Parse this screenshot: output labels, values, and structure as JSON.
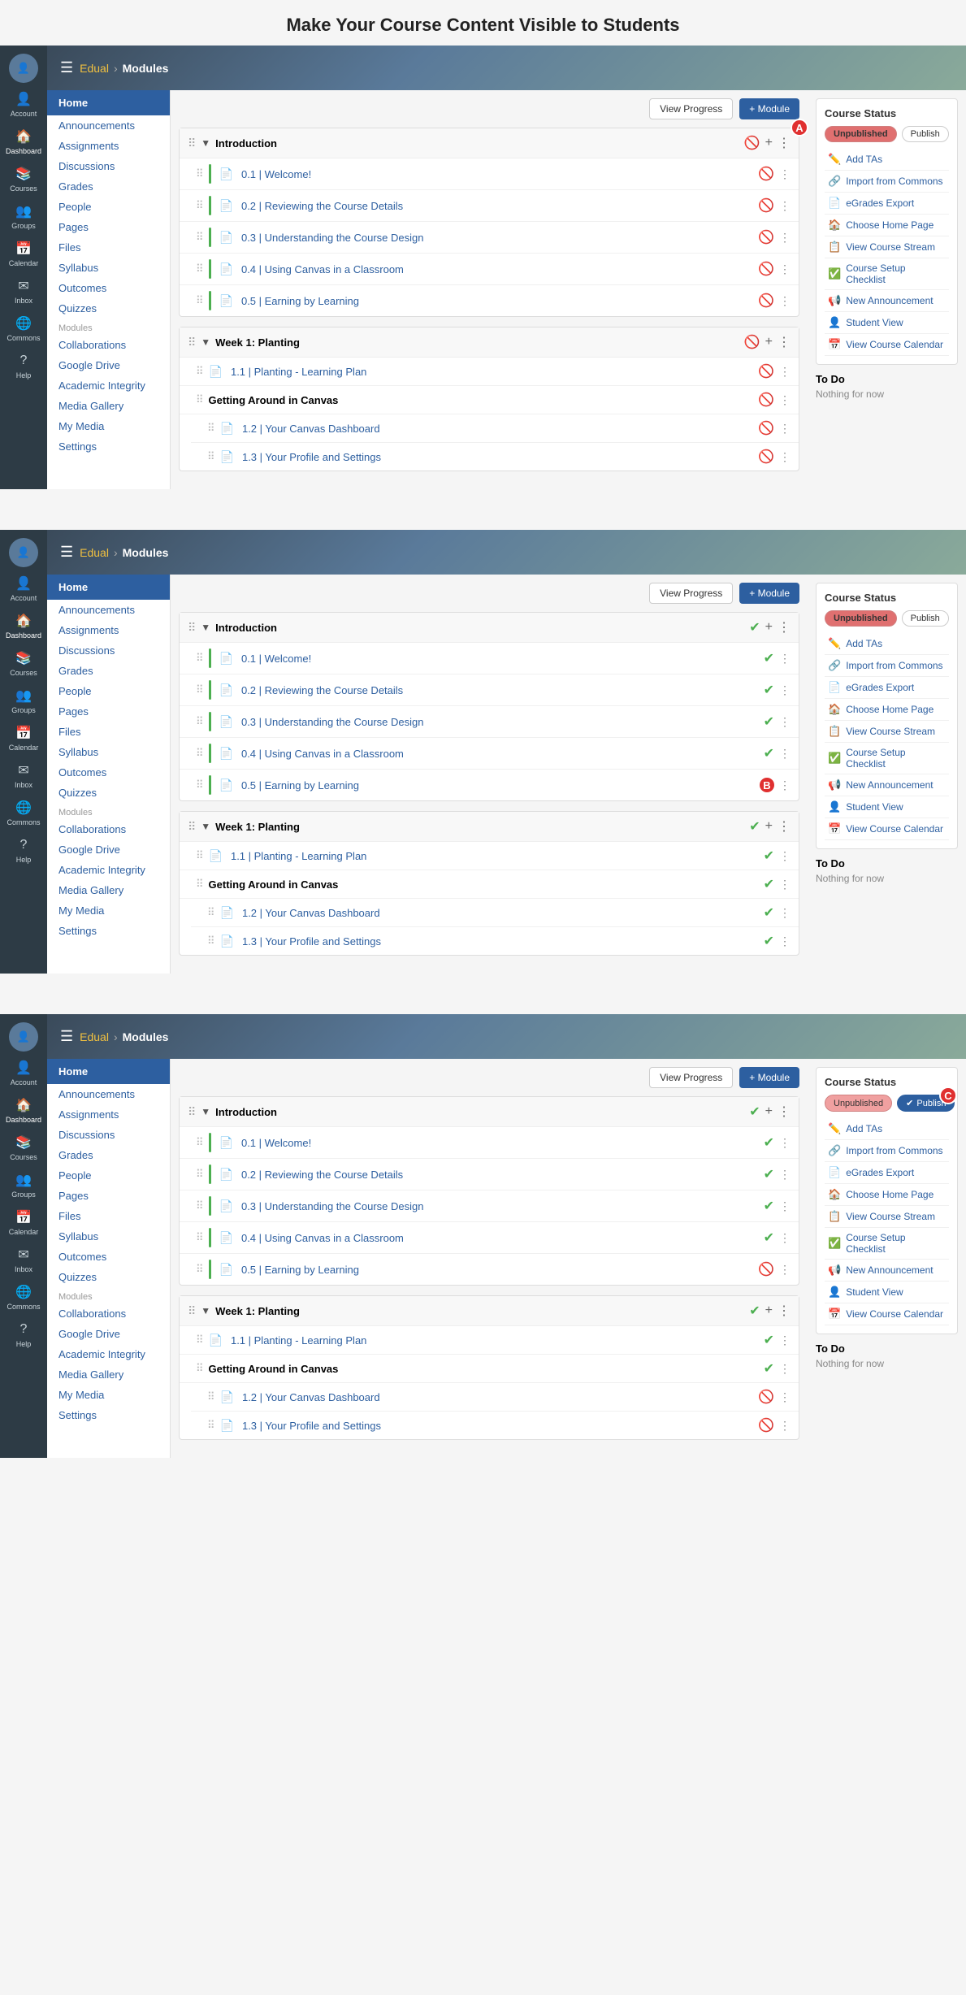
{
  "page": {
    "title": "Make Your Course Content Visible to Students"
  },
  "screens": [
    {
      "id": "screen-a",
      "annotation": "A",
      "banner": {
        "breadcrumb_link": "Edual",
        "breadcrumb_current": "Modules"
      },
      "left_nav": {
        "home": "Home",
        "items": [
          "Announcements",
          "Assignments",
          "Discussions",
          "Grades",
          "People",
          "Pages",
          "Files",
          "Syllabus",
          "Outcomes",
          "Quizzes",
          "Modules",
          "Collaborations",
          "Google Drive",
          "Academic Integrity",
          "Media Gallery",
          "My Media",
          "Settings"
        ]
      },
      "module_area": {
        "btn_view_progress": "View Progress",
        "btn_add_module": "+ Module",
        "modules": [
          {
            "title": "Introduction",
            "published": false,
            "items": [
              {
                "title": "0.1 | Welcome!",
                "has_bar": true,
                "published": false
              },
              {
                "title": "0.2 | Reviewing the Course Details",
                "has_bar": true,
                "published": false
              },
              {
                "title": "0.3 | Understanding the Course Design",
                "has_bar": true,
                "published": false
              },
              {
                "title": "0.4 | Using Canvas in a Classroom",
                "has_bar": true,
                "published": false
              },
              {
                "title": "0.5 | Earning by Learning",
                "has_bar": true,
                "published": false
              }
            ]
          },
          {
            "title": "Week 1: Planting",
            "published": false,
            "items": [
              {
                "title": "1.1 | Planting - Learning Plan",
                "has_bar": false,
                "published": false
              },
              {
                "sub_title": "Getting Around in Canvas",
                "published": false
              },
              {
                "title": "1.2 | Your Canvas Dashboard",
                "has_bar": false,
                "indent": true,
                "published": false
              },
              {
                "title": "1.3 | Your Profile and Settings",
                "has_bar": false,
                "indent": true,
                "published": false
              }
            ]
          }
        ]
      },
      "course_status": {
        "title": "Course Status",
        "unpublished_active": true,
        "publish_active": false,
        "actions": [
          "Add TAs",
          "Import from Commons",
          "eGrades Export",
          "Choose Home Page",
          "View Course Stream",
          "Course Setup Checklist",
          "New Announcement",
          "Student View",
          "View Course Calendar"
        ]
      },
      "todo": {
        "title": "To Do",
        "empty": "Nothing for now"
      }
    },
    {
      "id": "screen-b",
      "annotation": "B",
      "banner": {
        "breadcrumb_link": "Edual",
        "breadcrumb_current": "Modules"
      },
      "left_nav": {
        "home": "Home",
        "items": [
          "Announcements",
          "Assignments",
          "Discussions",
          "Grades",
          "People",
          "Pages",
          "Files",
          "Syllabus",
          "Outcomes",
          "Quizzes",
          "Modules",
          "Collaborations",
          "Google Drive",
          "Academic Integrity",
          "Media Gallery",
          "My Media",
          "Settings"
        ]
      },
      "module_area": {
        "btn_view_progress": "View Progress",
        "btn_add_module": "+ Module",
        "modules": [
          {
            "title": "Introduction",
            "published": true,
            "items": [
              {
                "title": "0.1 | Welcome!",
                "has_bar": true,
                "published": true
              },
              {
                "title": "0.2 | Reviewing the Course Details",
                "has_bar": true,
                "published": true
              },
              {
                "title": "0.3 | Understanding the Course Design",
                "has_bar": true,
                "published": true
              },
              {
                "title": "0.4 | Using Canvas in a Classroom",
                "has_bar": true,
                "published": true
              },
              {
                "title": "0.5 | Earning by Learning",
                "has_bar": true,
                "published": true
              }
            ]
          },
          {
            "title": "Week 1: Planting",
            "published": true,
            "items": [
              {
                "title": "1.1 | Planting - Learning Plan",
                "has_bar": false,
                "published": true
              },
              {
                "sub_title": "Getting Around in Canvas",
                "published": true
              },
              {
                "title": "1.2 | Your Canvas Dashboard",
                "has_bar": false,
                "indent": true,
                "published": true
              },
              {
                "title": "1.3 | Your Profile and Settings",
                "has_bar": false,
                "indent": true,
                "published": true
              }
            ]
          }
        ]
      },
      "course_status": {
        "title": "Course Status",
        "unpublished_active": true,
        "publish_active": false,
        "actions": [
          "Add TAs",
          "Import from Commons",
          "eGrades Export",
          "Choose Home Page",
          "View Course Stream",
          "Course Setup Checklist",
          "New Announcement",
          "Student View",
          "View Course Calendar"
        ]
      },
      "todo": {
        "title": "To Do",
        "empty": "Nothing for now"
      }
    },
    {
      "id": "screen-c",
      "annotation": "C",
      "banner": {
        "breadcrumb_link": "Edual",
        "breadcrumb_current": "Modules"
      },
      "left_nav": {
        "home": "Home",
        "items": [
          "Announcements",
          "Assignments",
          "Discussions",
          "Grades",
          "People",
          "Pages",
          "Files",
          "Syllabus",
          "Outcomes",
          "Quizzes",
          "Modules",
          "Collaborations",
          "Google Drive",
          "Academic Integrity",
          "Media Gallery",
          "My Media",
          "Settings"
        ]
      },
      "module_area": {
        "btn_view_progress": "View Progress",
        "btn_add_module": "+ Module",
        "modules": [
          {
            "title": "Introduction",
            "published": true,
            "items": [
              {
                "title": "0.1 | Welcome!",
                "has_bar": true,
                "published": true
              },
              {
                "title": "0.2 | Reviewing the Course Details",
                "has_bar": true,
                "published": true
              },
              {
                "title": "0.3 | Understanding the Course Design",
                "has_bar": true,
                "published": true
              },
              {
                "title": "0.4 | Using Canvas in a Classroom",
                "has_bar": true,
                "published": true
              },
              {
                "title": "0.5 | Earning by Learning",
                "has_bar": true,
                "published": false
              }
            ]
          },
          {
            "title": "Week 1: Planting",
            "published": true,
            "items": [
              {
                "title": "1.1 | Planting - Learning Plan",
                "has_bar": false,
                "published": true
              },
              {
                "sub_title": "Getting Around in Canvas",
                "published": true
              },
              {
                "title": "1.2 | Your Canvas Dashboard",
                "has_bar": false,
                "indent": true,
                "published": false
              },
              {
                "title": "1.3 | Your Profile and Settings",
                "has_bar": false,
                "indent": true,
                "published": false
              }
            ]
          }
        ]
      },
      "course_status": {
        "title": "Course Status",
        "unpublished_active": false,
        "publish_active": true,
        "actions": [
          "Add TAs",
          "Import from Commons",
          "eGrades Export",
          "Choose Home Page",
          "View Course Stream",
          "Course Setup Checklist",
          "New Announcement",
          "Student View",
          "View Course Calendar"
        ]
      },
      "todo": {
        "title": "To Do",
        "empty": "Nothing for now"
      }
    }
  ],
  "sidebar": {
    "items": [
      {
        "label": "Account",
        "icon": "👤"
      },
      {
        "label": "Dashboard",
        "icon": "🏠"
      },
      {
        "label": "Courses",
        "icon": "📚"
      },
      {
        "label": "Groups",
        "icon": "👥"
      },
      {
        "label": "Calendar",
        "icon": "📅"
      },
      {
        "label": "Inbox",
        "icon": "✉"
      },
      {
        "label": "Commons",
        "icon": "🌐"
      },
      {
        "label": "Help",
        "icon": "?"
      }
    ]
  },
  "action_icons": {
    "add_tas": "✏️",
    "import": "🔗",
    "egrades": "📄",
    "home_page": "🏠",
    "stream": "📋",
    "checklist": "✅",
    "announcement": "📢",
    "student": "👤",
    "calendar": "📅"
  }
}
